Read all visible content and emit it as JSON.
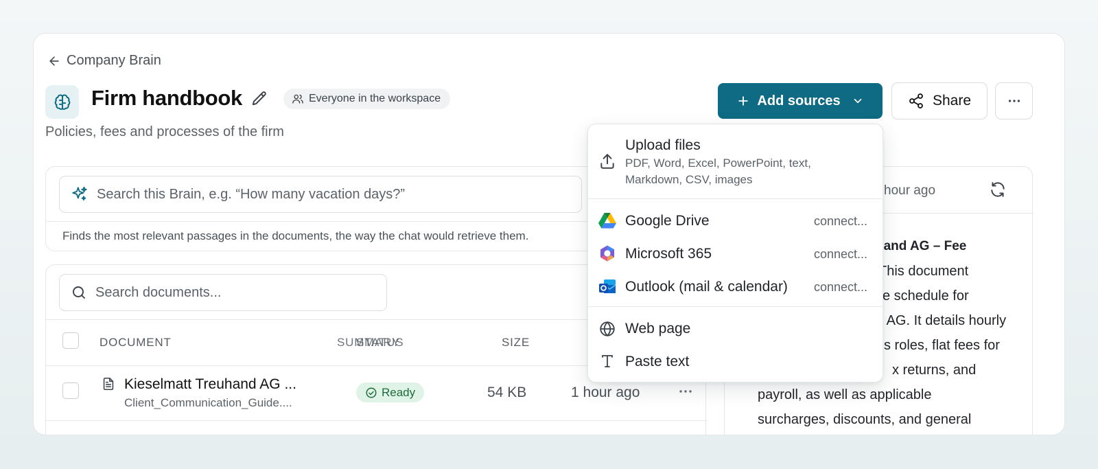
{
  "breadcrumb": {
    "label": "Company Brain"
  },
  "header": {
    "title": "Firm handbook",
    "audience": "Everyone in the workspace",
    "subtitle": "Policies, fees and processes of the firm",
    "add_sources_label": "Add sources",
    "share_label": "Share"
  },
  "brain_search": {
    "placeholder": "Search this Brain, e.g. “How many vacation days?”",
    "hint": "Finds the most relevant passages in the documents, the way the chat would retrieve them."
  },
  "documents": {
    "search_placeholder": "Search documents...",
    "columns": {
      "document": "DOCUMENT",
      "summary": "SUMMARY",
      "status": "STATUS",
      "size": "SIZE"
    },
    "rows": [
      {
        "name": "Kieselmatt Treuhand AG ...",
        "file": "Client_Communication_Guide....",
        "status": "Ready",
        "size": "54 KB",
        "updated": "1 hour ago"
      }
    ]
  },
  "summary": {
    "updated": "hour ago",
    "lines": [
      "hand AG – Fee",
      "This document",
      "e schedule for",
      "d AG. It details hourly",
      "s roles, flat fees for",
      "x returns, and",
      "payroll, as well as applicable",
      "surcharges, discounts, and general"
    ]
  },
  "add_sources_menu": {
    "upload": {
      "title": "Upload files",
      "description": "PDF, Word, Excel, PowerPoint, text, Markdown, CSV, images"
    },
    "integrations": [
      {
        "label": "Google Drive",
        "status": "connect..."
      },
      {
        "label": "Microsoft 365",
        "status": "connect..."
      },
      {
        "label": "Outlook (mail & calendar)",
        "status": "connect..."
      }
    ],
    "web_page": "Web page",
    "paste_text": "Paste text"
  },
  "colors": {
    "accent": "#0f6a83",
    "ready_bg": "#dff3e6",
    "ready_text": "#1d6b3c"
  },
  "icons": {
    "back": "arrow-left-icon",
    "brain": "brain-icon",
    "edit": "pencil-icon",
    "audience": "users-icon",
    "sparkle": "sparkle-icon",
    "search": "search-icon",
    "share": "share-icon",
    "more": "more-horizontal-icon",
    "upload": "upload-icon",
    "globe": "globe-icon",
    "text": "text-type-icon",
    "file": "file-text-icon",
    "check": "check-circle-icon",
    "refresh": "refresh-icon",
    "chevron": "chevron-down-icon",
    "plus": "plus-icon"
  }
}
